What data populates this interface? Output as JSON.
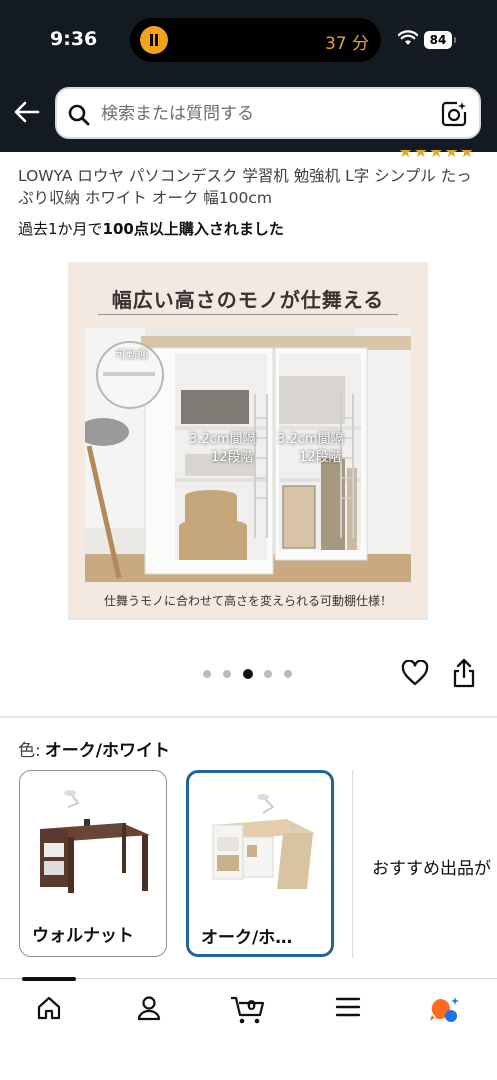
{
  "status_bar": {
    "time": "9:36",
    "timer": "37 分",
    "battery": "84"
  },
  "search": {
    "placeholder": "検索または質問する"
  },
  "product": {
    "title": "LOWYA ロウヤ パソコンデスク 学習机 勉強机 L字 シンプル たっぷり収納 ホワイト オーク 幅100cm",
    "purchases_prefix": "過去1か月で",
    "purchases_bold": "100点以上購入されました"
  },
  "image": {
    "headline": "幅広い高さのモノが仕舞える",
    "callout_movable": "可動棚",
    "spacing_left_1": "3.2cm間隔",
    "spacing_left_2": "12段階",
    "spacing_right_1": "3.2cm間隔",
    "spacing_right_2": "12段階",
    "caption": "仕舞うモノに合わせて高さを変えられる可動棚仕様！",
    "carousel_total": 5,
    "carousel_index": 3
  },
  "variation": {
    "label": "色:",
    "selected_value": "オーク/ホワイト",
    "options": [
      {
        "label": "ウォルナット",
        "selected": false
      },
      {
        "label": "オーク/ホ…",
        "selected": true
      }
    ],
    "recommended": "おすすめ出品が"
  },
  "colors": {
    "header_bg": "#131a22",
    "accent_selected": "#2162a1",
    "timer": "#f3a21a"
  }
}
